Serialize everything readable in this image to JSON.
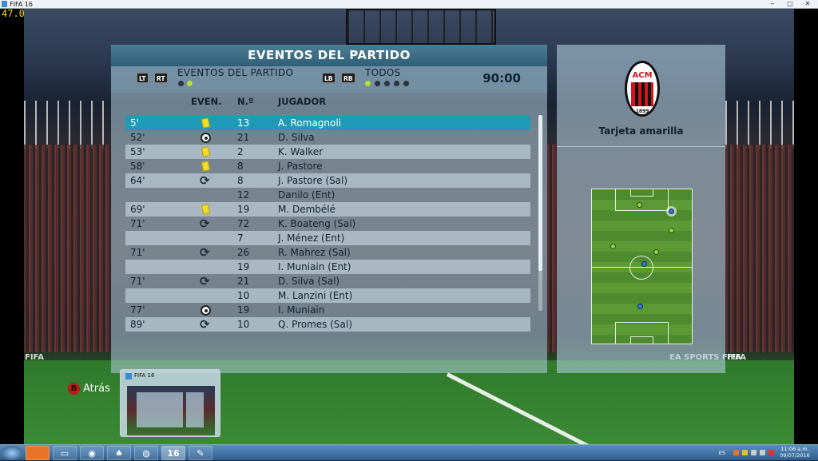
{
  "window": {
    "title": "FIFA 16",
    "fps": "47.0"
  },
  "panel": {
    "title": "EVENTOS DEL PARTIDO",
    "lt_label": "LT",
    "rt_label": "RT",
    "filter_left": "EVENTOS DEL PARTIDO",
    "lb_label": "LB",
    "rb_label": "RB",
    "filter_right": "TODOS",
    "clock": "90:00",
    "columns": {
      "event": "EVEN.",
      "number": "N.º",
      "player": "JUGADOR"
    }
  },
  "events": [
    {
      "minute": "5'",
      "type": "yellow-card",
      "number": "13",
      "player": "A. Romagnoli",
      "selected": true
    },
    {
      "minute": "52'",
      "type": "goal",
      "number": "21",
      "player": "D. Silva"
    },
    {
      "minute": "53'",
      "type": "yellow-card",
      "number": "2",
      "player": "K. Walker"
    },
    {
      "minute": "58'",
      "type": "yellow-card",
      "number": "8",
      "player": "J. Pastore"
    },
    {
      "minute": "64'",
      "type": "substitution",
      "number": "8",
      "player": "J. Pastore (Sal)"
    },
    {
      "minute": "",
      "type": "",
      "number": "12",
      "player": "Danilo (Ent)"
    },
    {
      "minute": "69'",
      "type": "yellow-card",
      "number": "19",
      "player": "M. Dembélé"
    },
    {
      "minute": "71'",
      "type": "substitution",
      "number": "72",
      "player": "K. Boateng (Sal)"
    },
    {
      "minute": "",
      "type": "",
      "number": "7",
      "player": "J. Ménez (Ent)"
    },
    {
      "minute": "71'",
      "type": "substitution",
      "number": "26",
      "player": "R. Mahrez (Sal)"
    },
    {
      "minute": "",
      "type": "",
      "number": "19",
      "player": "I. Muniain (Ent)"
    },
    {
      "minute": "71'",
      "type": "substitution",
      "number": "21",
      "player": "D. Silva (Sal)"
    },
    {
      "minute": "",
      "type": "",
      "number": "10",
      "player": "M. Lanzini (Ent)"
    },
    {
      "minute": "77'",
      "type": "goal",
      "number": "19",
      "player": "I. Muniain"
    },
    {
      "minute": "89'",
      "type": "substitution",
      "number": "10",
      "player": "Q. Promes (Sal)"
    }
  ],
  "detail": {
    "crest_text": "ACM",
    "crest_year": "1899",
    "caption": "Tarjeta amarilla"
  },
  "watermarks": [
    "FIFA",
    "EA SPORTS FIFA",
    "FIFA"
  ],
  "back_button": {
    "key": "B",
    "label": "Atrás"
  },
  "thumbnail": {
    "title": "FIFA 16"
  },
  "taskbar": {
    "fifa_label": "16",
    "lang": "ES",
    "time": "11:06 a.m.",
    "date": "09/07/2016"
  },
  "colors": {
    "selected_row": "#1f9bb8",
    "yellow_card": "#f2dc2a",
    "milan_red": "#d2141c"
  }
}
